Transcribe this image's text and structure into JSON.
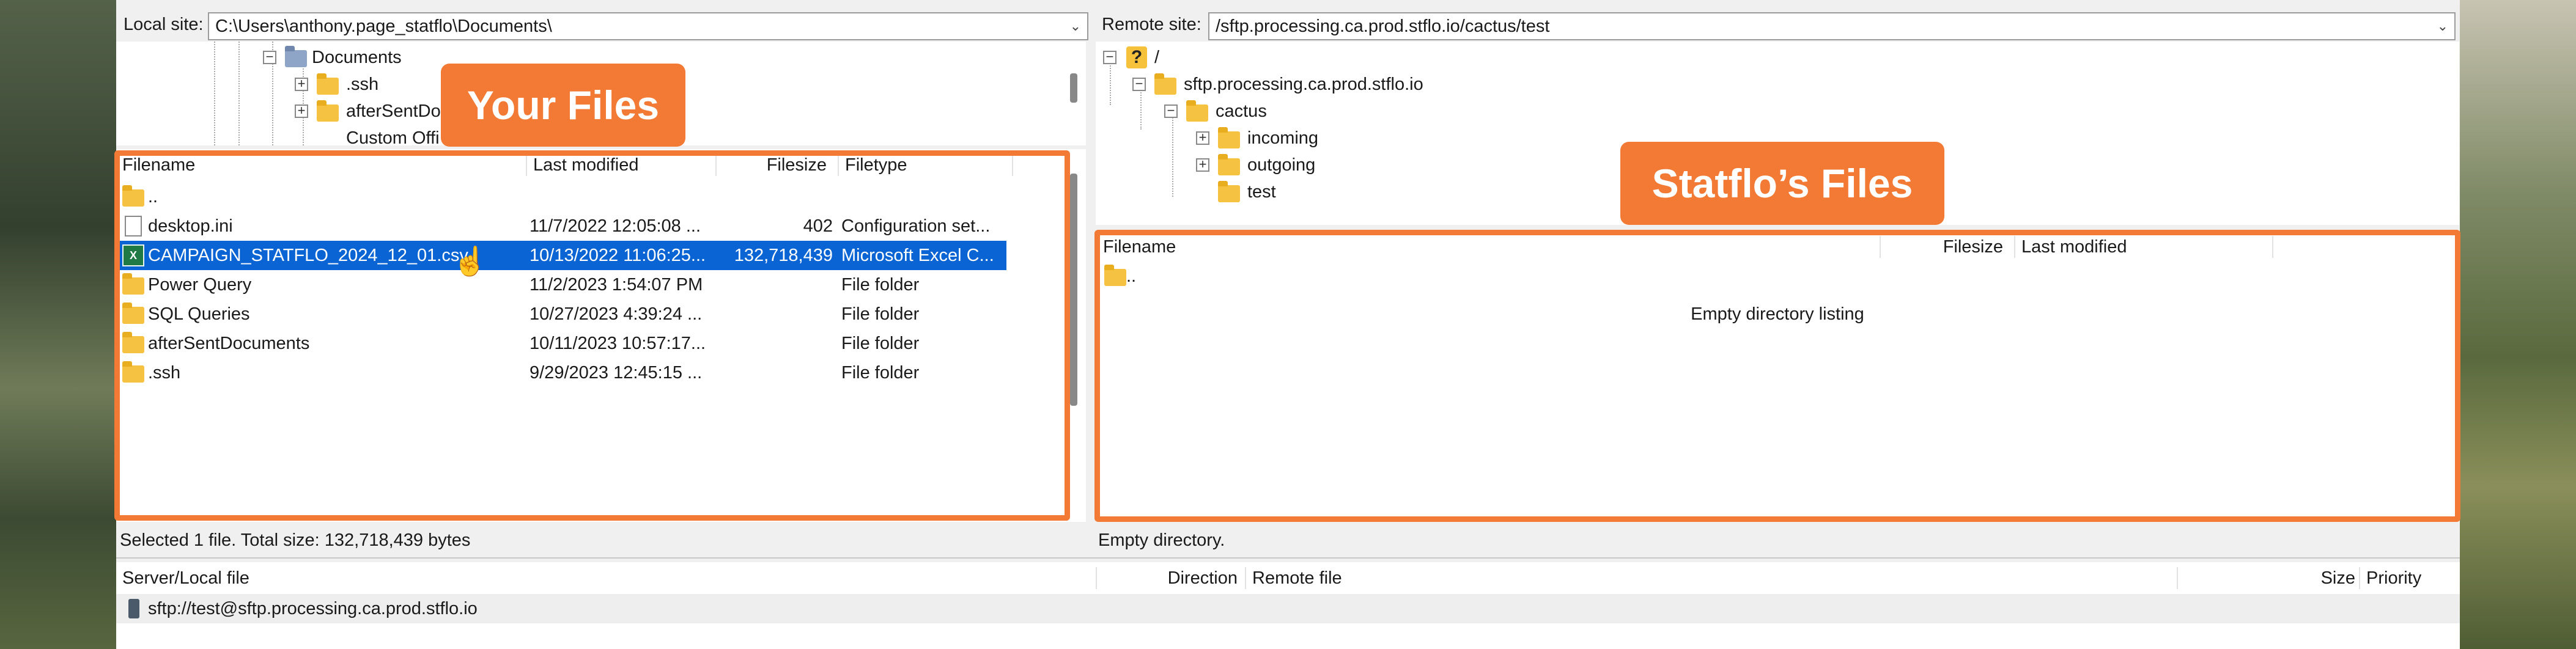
{
  "local": {
    "label": "Local site:",
    "path": "C:\\Users\\anthony.page_statflo\\Documents\\",
    "tree": [
      "Documents",
      ".ssh",
      "afterSentDo",
      "Custom Offi"
    ],
    "columns": [
      "Filename",
      "Last modified",
      "Filesize",
      "Filetype"
    ],
    "files": [
      {
        "name": "..",
        "modified": "",
        "size": "",
        "type": "",
        "icon": "folder-icon"
      },
      {
        "name": "desktop.ini",
        "modified": "11/7/2022 12:05:08 ...",
        "size": "402",
        "type": "Configuration set...",
        "icon": "file-icon"
      },
      {
        "name": "CAMPAIGN_STATFLO_2024_12_01.csv",
        "modified": "10/13/2022 11:06:25...",
        "size": "132,718,439",
        "type": "Microsoft Excel C...",
        "icon": "excel-icon"
      },
      {
        "name": "Power Query",
        "modified": "11/2/2023 1:54:07 PM",
        "size": "",
        "type": "File folder",
        "icon": "folder-icon"
      },
      {
        "name": "SQL Queries",
        "modified": "10/27/2023 4:39:24 ...",
        "size": "",
        "type": "File folder",
        "icon": "folder-icon"
      },
      {
        "name": "afterSentDocuments",
        "modified": "10/11/2023 10:57:17...",
        "size": "",
        "type": "File folder",
        "icon": "folder-icon"
      },
      {
        "name": ".ssh",
        "modified": "9/29/2023 12:45:15 ...",
        "size": "",
        "type": "File folder",
        "icon": "folder-icon"
      }
    ],
    "status": "Selected 1 file. Total size: 132,718,439 bytes",
    "callout": "Your Files"
  },
  "remote": {
    "label": "Remote site:",
    "path": "/sftp.processing.ca.prod.stflo.io/cactus/test",
    "tree": [
      "/",
      "sftp.processing.ca.prod.stflo.io",
      "cactus",
      "incoming",
      "outgoing",
      "test"
    ],
    "columns": [
      "Filename",
      "Filesize",
      "Last modified"
    ],
    "parent_entry": "..",
    "empty_message": "Empty directory listing",
    "status": "Empty directory.",
    "callout": "Statflo’s Files"
  },
  "queue": {
    "columns": [
      "Server/Local file",
      "Direction",
      "Remote file",
      "Size",
      "Priority"
    ],
    "server": "sftp://test@sftp.processing.ca.prod.stflo.io"
  },
  "colors": {
    "accent": "#f37a35",
    "selection": "#0a64d4"
  }
}
